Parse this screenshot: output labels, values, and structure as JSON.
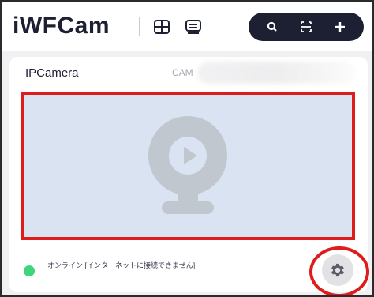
{
  "header": {
    "app_title": "iWFCam",
    "icons": {
      "grid_view": "grid-view-icon",
      "list_view": "list-view-icon",
      "search": "search-icon",
      "scan": "scan-icon",
      "add": "add-icon"
    }
  },
  "device_card": {
    "name": "IPCamera",
    "id_prefix": "CAM",
    "status_text": "オンライン [インターネットに接続できません]",
    "status_color": "#3fd67b",
    "settings_icon": "gear-icon"
  },
  "colors": {
    "accent_dark": "#1d1f33",
    "highlight_red": "#e01b1b",
    "preview_bg": "#d9e3f1"
  }
}
